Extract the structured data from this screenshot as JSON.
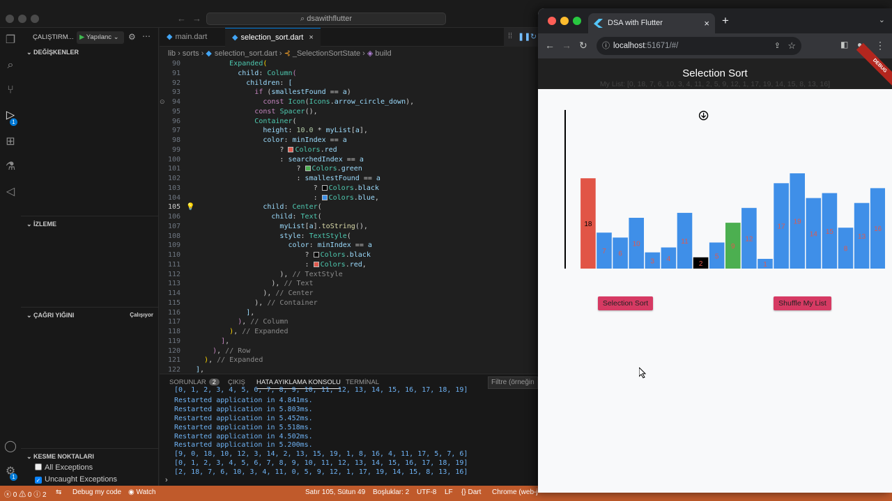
{
  "vscode": {
    "command_center": "dsawithflutter",
    "run_label": "ÇALIŞTIRM...",
    "config_label": "Yapılanc",
    "variables_header": "DEĞİŞKENLER",
    "watch_header": "İZLEME",
    "callstack_header": "ÇAĞRI YIĞINI",
    "callstack_status": "Çalışıyor",
    "breakpoints_header": "KESME NOKTALARI",
    "bp_all": "All Exceptions",
    "bp_uncaught": "Uncaught Exceptions",
    "debug_badge": "1",
    "account_badge": "1",
    "tabs": [
      {
        "label": "main.dart"
      },
      {
        "label": "selection_sort.dart"
      }
    ],
    "breadcrumb": [
      "lib",
      "sorts",
      "selection_sort.dart",
      "_SelectionSortState",
      "build"
    ],
    "code_lines": [
      {
        "n": "90",
        "html": "        <span class=\"t\">Expanded</span><span class=\"p\">(</span>"
      },
      {
        "n": "91",
        "html": "          <span class=\"v\">child</span>: <span class=\"t\">Column</span><span class=\"k\">(</span>"
      },
      {
        "n": "92",
        "html": "            <span class=\"v\">children</span>: <span class=\"v\">[</span>"
      },
      {
        "n": "93",
        "html": "              <span class=\"k\">if</span> (<span class=\"v\">smallestFound</span> == <span class=\"v\">a</span>)"
      },
      {
        "n": "94",
        "html": "                <span class=\"k\">const</span> <span class=\"t\">Icon</span>(<span class=\"t\">Icons</span>.<span class=\"v\">arrow_circle_down</span>),"
      },
      {
        "n": "95",
        "html": "              <span class=\"k\">const</span> <span class=\"t\">Spacer</span>(),"
      },
      {
        "n": "96",
        "html": "              <span class=\"t\">Container</span>("
      },
      {
        "n": "97",
        "html": "                <span class=\"v\">height</span>: <span class=\"n\">10.0</span> * <span class=\"v\">myList</span>[<span class=\"v\">a</span>],"
      },
      {
        "n": "98",
        "html": "                <span class=\"v\">color</span>: <span class=\"v\">minIndex</span> == <span class=\"v\">a</span>"
      },
      {
        "n": "99",
        "html": "                    ? <span class=\"sw\" style=\"background:#e05a4e\"></span><span class=\"t\">Colors</span>.<span class=\"v\">red</span>"
      },
      {
        "n": "100",
        "html": "                    : <span class=\"v\">searchedIndex</span> == <span class=\"v\">a</span>"
      },
      {
        "n": "101",
        "html": "                        ? <span class=\"sw\" style=\"background:#4caf50\"></span><span class=\"t\">Colors</span>.<span class=\"v\">green</span>"
      },
      {
        "n": "102",
        "html": "                        : <span class=\"v\">smallestFound</span> == <span class=\"v\">a</span>"
      },
      {
        "n": "103",
        "html": "                            ? <span class=\"sw\" style=\"background:#000\"></span><span class=\"t\">Colors</span>.<span class=\"v\">black</span>"
      },
      {
        "n": "104",
        "html": "                            : <span class=\"sw\" style=\"background:#3d8fe6\"></span><span class=\"t\">Colors</span>.<span class=\"v\">blue</span>,"
      },
      {
        "n": "105",
        "html": "                <span class=\"v\">child</span>: <span class=\"t\">Center</span>("
      },
      {
        "n": "106",
        "html": "                  <span class=\"v\">child</span>: <span class=\"t\">Text</span>("
      },
      {
        "n": "107",
        "html": "                    <span class=\"v\">myList</span>[<span class=\"v\">a</span>].<span class=\"f\">toString</span>(),"
      },
      {
        "n": "108",
        "html": "                    <span class=\"v\">style</span>: <span class=\"t\">TextStyle</span>("
      },
      {
        "n": "109",
        "html": "                      <span class=\"v\">color</span>: <span class=\"v\">minIndex</span> == <span class=\"v\">a</span>"
      },
      {
        "n": "110",
        "html": "                          ? <span class=\"sw\" style=\"background:#000\"></span><span class=\"t\">Colors</span>.<span class=\"v\">black</span>"
      },
      {
        "n": "111",
        "html": "                          : <span class=\"sw\" style=\"background:#e05a4e\"></span><span class=\"t\">Colors</span>.<span class=\"v\">red</span>,"
      },
      {
        "n": "112",
        "html": "                    ), <span class=\"cm\">// TextStyle</span>"
      },
      {
        "n": "113",
        "html": "                  ), <span class=\"cm\">// Text</span>"
      },
      {
        "n": "114",
        "html": "                ), <span class=\"cm\">// Center</span>"
      },
      {
        "n": "115",
        "html": "              ), <span class=\"cm\">// Container</span>"
      },
      {
        "n": "116",
        "html": "            <span class=\"v\">]</span>,"
      },
      {
        "n": "117",
        "html": "          <span class=\"k\">)</span>, <span class=\"cm\">// Column</span>"
      },
      {
        "n": "118",
        "html": "        <span class=\"p\">)</span>, <span class=\"cm\">// Expanded</span>"
      },
      {
        "n": "119",
        "html": "      <span class=\"k\">]</span>,"
      },
      {
        "n": "120",
        "html": "    <span class=\"k\">)</span>, <span class=\"cm\">// Row</span>"
      },
      {
        "n": "121",
        "html": "  <span class=\"p\">)</span>, <span class=\"cm\">// Expanded</span>"
      },
      {
        "n": "122",
        "html": "<span class=\"v\">]</span>,"
      }
    ],
    "current_line": "105",
    "panel_tabs": [
      {
        "label": "SORUNLAR",
        "count": "2"
      },
      {
        "label": "ÇIKIŞ"
      },
      {
        "label": "HATA AYIKLAMA KONSOLU"
      },
      {
        "label": "TERMİNAL"
      }
    ],
    "filter_placeholder": "Filtre (örneğin",
    "console_lines": [
      "[0, 1, 2, 3, 4, 5, 6, 7, 8, 9, 10, 11, 12, 13, 14, 15, 16, 17, 18, 19]",
      "Restarted application in 4.841ms.",
      "Restarted application in 5.803ms.",
      "Restarted application in 5.452ms.",
      "Restarted application in 5.518ms.",
      "Restarted application in 4.502ms.",
      "Restarted application in 5.200ms.",
      "[9, 0, 18, 10, 12, 3, 14, 2, 13, 15, 19, 1, 8, 16, 4, 11, 17, 5, 7, 6]",
      "[0, 1, 2, 3, 4, 5, 6, 7, 8, 9, 10, 11, 12, 13, 14, 15, 16, 17, 18, 19]",
      "[2, 18, 7, 6, 10, 3, 4, 11, 0, 5, 9, 12, 1, 17, 19, 14, 15, 8, 13, 16]"
    ],
    "status": {
      "errors": "0",
      "warnings": "0",
      "info": "2",
      "debug_mode": "Debug my code",
      "watch": "Watch",
      "position": "Satır 105, Sütun 49",
      "spaces": "Boşluklar: 2",
      "encoding": "UTF-8",
      "eol": "LF",
      "language": "Dart",
      "device": "Chrome (web-j"
    }
  },
  "browser": {
    "tab_title": "DSA with Flutter",
    "url_host": "localhost",
    "url_rest": ":51671/#/",
    "app_title": "Selection Sort",
    "debug_banner": "DEBUG",
    "my_list_text": "My List: [0, 18, 7, 6, 10, 3, 4, 11, 2, 5, 9, 12, 1, 17, 19, 14, 15, 8, 13, 16]",
    "button_sort": "Selection Sort",
    "button_shuffle": "Shuffle My List"
  },
  "chart_data": {
    "type": "bar",
    "values": [
      0,
      18,
      7,
      6,
      10,
      3,
      4,
      11,
      2,
      5,
      9,
      12,
      1,
      17,
      19,
      14,
      15,
      8,
      13,
      16
    ],
    "labels": [
      "0",
      "18",
      "7",
      "6",
      "10",
      "3",
      "4",
      "11",
      "2",
      "5",
      "9",
      "12",
      "1",
      "17",
      "19",
      "14",
      "15",
      "8",
      "13",
      "16"
    ],
    "min_index": 1,
    "searched_index": 10,
    "smallest_found": 8,
    "colors": {
      "min": "#e15546",
      "searched": "#4caf50",
      "smallest": "#000000",
      "default": "#3f8fe8"
    }
  }
}
